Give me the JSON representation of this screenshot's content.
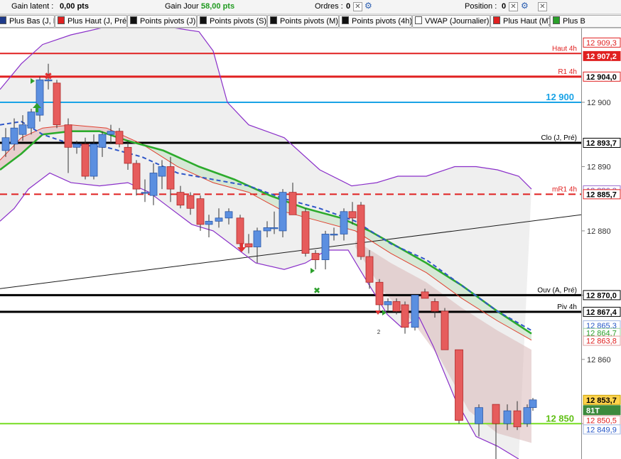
{
  "toolbar": {
    "gain_latent_label": "Gain latent :",
    "gain_latent_value": "0,00 pts",
    "gain_jour_label": "Gain Jour :",
    "gain_jour_value": "58,00 pts",
    "ordres_label": "Ordres :",
    "ordres_value": "0",
    "position_label": "Position :",
    "position_value": "0"
  },
  "tabs": [
    {
      "label": "Plus Bas (J, Pré)",
      "color": "#1e3a8a"
    },
    {
      "label": "Plus Haut (J, Pré)",
      "color": "#e02020"
    },
    {
      "label": "Points pivots (J)",
      "color": "#111111"
    },
    {
      "label": "Points pivots (S)",
      "color": "#111111"
    },
    {
      "label": "Points pivots (M)",
      "color": "#111111"
    },
    {
      "label": "Points pivots (4h)",
      "color": "#111111"
    },
    {
      "label": "VWAP (Journalier)",
      "color": "#ffffff"
    },
    {
      "label": "Plus Haut (M)",
      "color": "#e02020"
    },
    {
      "label": "Plus B",
      "color": "#2aa02a"
    }
  ],
  "chart_data": {
    "type": "candlestick",
    "ylim": [
      12844.5,
      12911.5
    ],
    "y_ticks": [
      12850,
      12860,
      12870,
      12880,
      12890,
      12900
    ],
    "y_tick_labels": [
      "12 850",
      "12 860",
      "12 870",
      "12 880",
      "12 890",
      "12 900"
    ],
    "candle_x": [
      8,
      20,
      32,
      44,
      56,
      68,
      80,
      96,
      108,
      120,
      132,
      144,
      156,
      168,
      180,
      192,
      204,
      216,
      228,
      240,
      254,
      268,
      282,
      294,
      308,
      322,
      338,
      350,
      362,
      376,
      386,
      398,
      412,
      430,
      444,
      458,
      470,
      484,
      496,
      508,
      520,
      534,
      546,
      558,
      570,
      584,
      598,
      612,
      626,
      646,
      674,
      698,
      714,
      728,
      742,
      750
    ],
    "candles": [
      {
        "o": 12892.5,
        "h": 12896.0,
        "l": 12891.5,
        "c": 12894.5
      },
      {
        "o": 12893.5,
        "h": 12897.5,
        "l": 12892.5,
        "c": 12896.0
      },
      {
        "o": 12895.0,
        "h": 12898.0,
        "l": 12894.0,
        "c": 12896.5
      },
      {
        "o": 12896.0,
        "h": 12899.0,
        "l": 12895.0,
        "c": 12898.5
      },
      {
        "o": 12898.0,
        "h": 12904.0,
        "l": 12897.0,
        "c": 12903.5
      },
      {
        "o": 12903.5,
        "h": 12906.0,
        "l": 12902.0,
        "c": 12903.5
      },
      {
        "o": 12903.0,
        "h": 12903.5,
        "l": 12896.0,
        "c": 12896.5
      },
      {
        "o": 12896.5,
        "h": 12897.5,
        "l": 12889.0,
        "c": 12893.0
      },
      {
        "o": 12893.0,
        "h": 12894.0,
        "l": 12892.0,
        "c": 12893.5
      },
      {
        "o": 12893.5,
        "h": 12894.5,
        "l": 12888.0,
        "c": 12888.5
      },
      {
        "o": 12888.5,
        "h": 12895.0,
        "l": 12888.0,
        "c": 12893.5
      },
      {
        "o": 12893.0,
        "h": 12895.5,
        "l": 12891.5,
        "c": 12895.0
      },
      {
        "o": 12895.0,
        "h": 12896.5,
        "l": 12893.5,
        "c": 12895.5
      },
      {
        "o": 12895.5,
        "h": 12896.0,
        "l": 12893.0,
        "c": 12893.5
      },
      {
        "o": 12893.0,
        "h": 12894.0,
        "l": 12889.5,
        "c": 12890.5
      },
      {
        "o": 12890.5,
        "h": 12891.0,
        "l": 12885.5,
        "c": 12886.5
      },
      {
        "o": 12886.0,
        "h": 12888.0,
        "l": 12884.5,
        "c": 12886.0
      },
      {
        "o": 12885.5,
        "h": 12890.5,
        "l": 12884.0,
        "c": 12889.0
      },
      {
        "o": 12888.5,
        "h": 12891.0,
        "l": 12886.5,
        "c": 12890.0
      },
      {
        "o": 12890.0,
        "h": 12891.5,
        "l": 12884.5,
        "c": 12886.5
      },
      {
        "o": 12886.0,
        "h": 12887.0,
        "l": 12883.5,
        "c": 12884.0
      },
      {
        "o": 12885.5,
        "h": 12886.0,
        "l": 12882.5,
        "c": 12883.5
      },
      {
        "o": 12885.0,
        "h": 12885.5,
        "l": 12880.0,
        "c": 12881.0
      },
      {
        "o": 12881.0,
        "h": 12882.5,
        "l": 12879.0,
        "c": 12881.5
      },
      {
        "o": 12881.5,
        "h": 12883.5,
        "l": 12880.5,
        "c": 12882.0
      },
      {
        "o": 12882.0,
        "h": 12883.5,
        "l": 12881.0,
        "c": 12883.0
      },
      {
        "o": 12882.0,
        "h": 12882.5,
        "l": 12877.5,
        "c": 12878.0
      },
      {
        "o": 12878.0,
        "h": 12879.5,
        "l": 12876.5,
        "c": 12877.5
      },
      {
        "o": 12877.5,
        "h": 12880.5,
        "l": 12875.0,
        "c": 12880.0
      },
      {
        "o": 12880.0,
        "h": 12881.5,
        "l": 12879.0,
        "c": 12880.5
      },
      {
        "o": 12880.5,
        "h": 12883.0,
        "l": 12879.5,
        "c": 12880.5
      },
      {
        "o": 12880.0,
        "h": 12886.5,
        "l": 12879.0,
        "c": 12886.0
      },
      {
        "o": 12886.0,
        "h": 12887.5,
        "l": 12882.5,
        "c": 12882.5
      },
      {
        "o": 12883.0,
        "h": 12883.5,
        "l": 12876.0,
        "c": 12876.5
      },
      {
        "o": 12876.5,
        "h": 12877.0,
        "l": 12874.0,
        "c": 12875.5
      },
      {
        "o": 12875.5,
        "h": 12880.0,
        "l": 12874.0,
        "c": 12879.5
      },
      {
        "o": 12879.5,
        "h": 12880.5,
        "l": 12878.5,
        "c": 12879.5
      },
      {
        "o": 12879.5,
        "h": 12883.5,
        "l": 12878.5,
        "c": 12883.0
      },
      {
        "o": 12883.0,
        "h": 12884.5,
        "l": 12881.0,
        "c": 12882.0
      },
      {
        "o": 12884.0,
        "h": 12884.5,
        "l": 12875.5,
        "c": 12876.0
      },
      {
        "o": 12876.0,
        "h": 12877.0,
        "l": 12871.0,
        "c": 12872.0
      },
      {
        "o": 12872.0,
        "h": 12872.5,
        "l": 12867.5,
        "c": 12868.5
      },
      {
        "o": 12868.5,
        "h": 12869.5,
        "l": 12867.5,
        "c": 12869.0
      },
      {
        "o": 12869.0,
        "h": 12869.5,
        "l": 12867.0,
        "c": 12867.5
      },
      {
        "o": 12868.5,
        "h": 12869.0,
        "l": 12864.0,
        "c": 12865.0
      },
      {
        "o": 12865.0,
        "h": 12870.0,
        "l": 12864.5,
        "c": 12870.0
      },
      {
        "o": 12870.5,
        "h": 12871.0,
        "l": 12869.5,
        "c": 12869.5
      },
      {
        "o": 12869.0,
        "h": 12869.5,
        "l": 12866.5,
        "c": 12867.5
      },
      {
        "o": 12867.5,
        "h": 12868.0,
        "l": 12861.5,
        "c": 12861.5
      },
      {
        "o": 12861.5,
        "h": 12861.5,
        "l": 12850.0,
        "c": 12850.5
      },
      {
        "o": 12850.0,
        "h": 12853.0,
        "l": 12848.0,
        "c": 12852.5
      },
      {
        "o": 12853.0,
        "h": 12853.0,
        "l": 12844.5,
        "c": 12850.0
      },
      {
        "o": 12850.0,
        "h": 12853.0,
        "l": 12849.0,
        "c": 12852.0
      },
      {
        "o": 12852.0,
        "h": 12853.5,
        "l": 12849.0,
        "c": 12849.5
      },
      {
        "o": 12850.0,
        "h": 12853.0,
        "l": 12849.5,
        "c": 12852.5
      },
      {
        "o": 12852.5,
        "h": 12854.0,
        "l": 12852.0,
        "c": 12853.7
      }
    ],
    "bollinger_upper": [
      [
        0,
        12902.0
      ],
      [
        30,
        12906.0
      ],
      [
        60,
        12909.0
      ],
      [
        100,
        12910.5
      ],
      [
        160,
        12912.0
      ],
      [
        220,
        12912.0
      ],
      [
        280,
        12911.0
      ],
      [
        300,
        12908.0
      ],
      [
        320,
        12900.0
      ],
      [
        350,
        12896.5
      ],
      [
        400,
        12894.5
      ],
      [
        450,
        12889.5
      ],
      [
        495,
        12887.0
      ],
      [
        530,
        12887.5
      ],
      [
        560,
        12888.5
      ],
      [
        600,
        12888.5
      ],
      [
        640,
        12890.0
      ],
      [
        670,
        12890.0
      ],
      [
        700,
        12889.5
      ],
      [
        730,
        12888.5
      ],
      [
        748,
        12886.5
      ]
    ],
    "bollinger_lower": [
      [
        0,
        12881.5
      ],
      [
        20,
        12883.5
      ],
      [
        40,
        12886.5
      ],
      [
        70,
        12889.0
      ],
      [
        100,
        12887.5
      ],
      [
        140,
        12887.0
      ],
      [
        180,
        12887.5
      ],
      [
        210,
        12886.0
      ],
      [
        240,
        12883.5
      ],
      [
        270,
        12881.0
      ],
      [
        300,
        12880.0
      ],
      [
        330,
        12877.5
      ],
      [
        360,
        12875.0
      ],
      [
        400,
        12874.0
      ],
      [
        430,
        12875.0
      ],
      [
        460,
        12877.0
      ],
      [
        490,
        12877.0
      ],
      [
        520,
        12871.5
      ],
      [
        545,
        12867.0
      ],
      [
        565,
        12865.0
      ],
      [
        590,
        12866.5
      ],
      [
        610,
        12862.0
      ],
      [
        640,
        12854.0
      ],
      [
        670,
        12848.0
      ],
      [
        700,
        12846.5
      ],
      [
        730,
        12844.5
      ]
    ],
    "sma_red": [
      [
        0,
        12891.0
      ],
      [
        30,
        12894.5
      ],
      [
        60,
        12896.0
      ],
      [
        100,
        12896.5
      ],
      [
        150,
        12896.0
      ],
      [
        200,
        12893.5
      ],
      [
        250,
        12890.0
      ],
      [
        300,
        12887.5
      ],
      [
        350,
        12886.0
      ],
      [
        400,
        12883.0
      ],
      [
        450,
        12881.5
      ],
      [
        500,
        12880.0
      ],
      [
        550,
        12876.5
      ],
      [
        600,
        12873.5
      ],
      [
        650,
        12869.5
      ],
      [
        700,
        12866.0
      ],
      [
        748,
        12863.0
      ]
    ],
    "ema_green": [
      [
        0,
        12889.5
      ],
      [
        30,
        12892.0
      ],
      [
        60,
        12895.0
      ],
      [
        100,
        12895.5
      ],
      [
        140,
        12895.5
      ],
      [
        180,
        12894.0
      ],
      [
        230,
        12892.5
      ],
      [
        280,
        12890.0
      ],
      [
        330,
        12888.0
      ],
      [
        380,
        12885.5
      ],
      [
        430,
        12883.5
      ],
      [
        480,
        12882.0
      ],
      [
        520,
        12880.0
      ],
      [
        560,
        12877.5
      ],
      [
        600,
        12875.0
      ],
      [
        650,
        12871.5
      ],
      [
        700,
        12867.5
      ],
      [
        748,
        12864.0
      ]
    ],
    "vwap_blue": [
      [
        0,
        12896.5
      ],
      [
        30,
        12897.0
      ],
      [
        60,
        12895.0
      ],
      [
        100,
        12893.5
      ],
      [
        150,
        12893.0
      ],
      [
        200,
        12891.5
      ],
      [
        250,
        12889.0
      ],
      [
        300,
        12888.0
      ],
      [
        350,
        12887.0
      ],
      [
        400,
        12885.0
      ],
      [
        450,
        12883.5
      ],
      [
        500,
        12881.5
      ],
      [
        550,
        12878.0
      ],
      [
        600,
        12875.5
      ],
      [
        650,
        12871.5
      ],
      [
        700,
        12867.5
      ],
      [
        748,
        12864.5
      ]
    ],
    "trendline": [
      [
        0,
        12871.0
      ],
      [
        818,
        12882.5
      ]
    ],
    "levels": [
      {
        "value": 12907.6,
        "color": "#e02020",
        "width": 2,
        "dash": "",
        "label": "Haut 4h",
        "label_color": "#e02020"
      },
      {
        "value": 12904.0,
        "color": "#e02020",
        "width": 3,
        "dash": "",
        "label": "R1 4h",
        "label_color": "#e02020"
      },
      {
        "value": 12900.0,
        "color": "#1aa3e6",
        "width": 2,
        "dash": "",
        "label": "12 900",
        "label_color": "#1aa3e6"
      },
      {
        "value": 12893.7,
        "color": "#000000",
        "width": 3,
        "dash": "",
        "label": "Clo (J, Pré)",
        "label_color": "#000000"
      },
      {
        "value": 12885.7,
        "color": "#e02020",
        "width": 2,
        "dash": "10,6",
        "label": "mR1 4h",
        "label_color": "#e02020"
      },
      {
        "value": 12870.0,
        "color": "#000000",
        "width": 3,
        "dash": "",
        "label": "Ouv (A, Pré)",
        "label_color": "#000000"
      },
      {
        "value": 12867.4,
        "color": "#000000",
        "width": 3,
        "dash": "",
        "label": "Piv 4h",
        "label_color": "#000000"
      },
      {
        "value": 12850.0,
        "color": "#77dd22",
        "width": 2,
        "dash": "",
        "label": "12 850",
        "label_color": "#5fbf14"
      }
    ],
    "axis_labels": [
      {
        "value": 12909.3,
        "text": "12 909,3",
        "bg": "#ffffff",
        "fg": "#e02020",
        "border": "#e02020"
      },
      {
        "value": 12907.2,
        "text": "12 907,2",
        "bg": "#e02020",
        "fg": "#ffffff",
        "border": "#e02020"
      },
      {
        "value": 12904.0,
        "text": "12 904,0",
        "bg": "#ffffff",
        "fg": "#000000",
        "border": "#e02020"
      },
      {
        "value": 12893.7,
        "text": "12 893,7",
        "bg": "#ffffff",
        "fg": "#000000",
        "border": "#000000"
      },
      {
        "value": 12886.3,
        "text": "12 886,3",
        "bg": "#ffffff",
        "fg": "#7b4db0",
        "border": "#9b6fd0"
      },
      {
        "value": 12885.7,
        "text": "12 885,7",
        "bg": "#ffffff",
        "fg": "#000000",
        "border": "#e02020"
      },
      {
        "value": 12870.0,
        "text": "12 870,0",
        "bg": "#ffffff",
        "fg": "#000000",
        "border": "#000000"
      },
      {
        "value": 12867.4,
        "text": "12 867,4",
        "bg": "#ffffff",
        "fg": "#000000",
        "border": "#000000"
      },
      {
        "value": 12865.3,
        "text": "12 865,3",
        "bg": "#ffffff",
        "fg": "#2456c8",
        "border": "#9fb4e0"
      },
      {
        "value": 12864.1,
        "text": "12 864,7",
        "bg": "#ffffff",
        "fg": "#2aa02a",
        "border": "#9fd09f"
      },
      {
        "value": 12862.9,
        "text": "12 863,8",
        "bg": "#ffffff",
        "fg": "#e02020",
        "border": "#e0a0a0"
      },
      {
        "value": 12853.7,
        "text": "12 853,7",
        "bg": "#ffd34d",
        "fg": "#000000",
        "border": "#c9a000"
      },
      {
        "value": 12852.1,
        "text": "81T",
        "bg": "#3c8a3c",
        "fg": "#ffffff",
        "border": "#3c8a3c"
      },
      {
        "value": 12850.5,
        "text": "12 850,5",
        "bg": "#ffffff",
        "fg": "#e02020",
        "border": "#e0a0a0"
      },
      {
        "value": 12849.1,
        "text": "12 849,9",
        "bg": "#ffffff",
        "fg": "#2456c8",
        "border": "#9fb4e0"
      }
    ],
    "annotations": [
      {
        "text": "2",
        "x": 533,
        "value": 12865.5
      }
    ],
    "colors": {
      "up": "#5b8fe0",
      "down": "#e65c5c",
      "bollinger": "#8a2fc9"
    }
  }
}
